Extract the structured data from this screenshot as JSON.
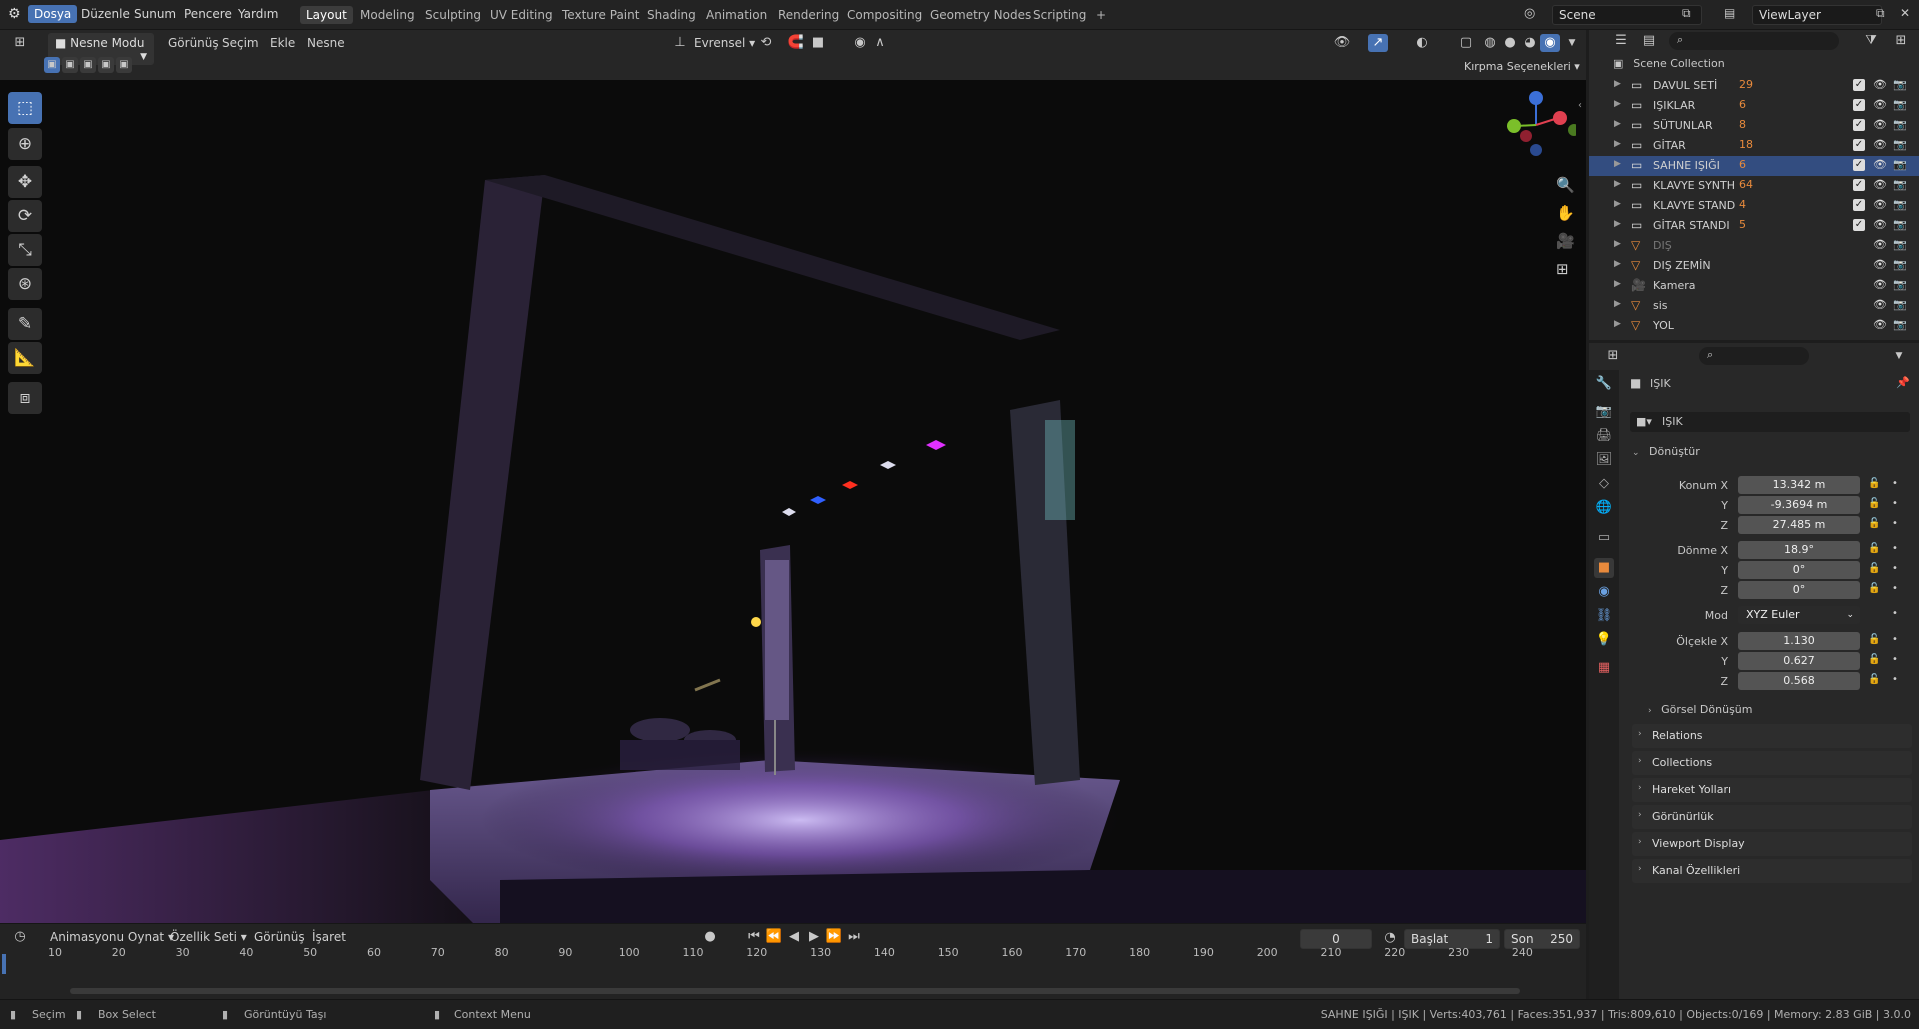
{
  "topbar": {
    "menus": [
      "Dosya",
      "Düzenle",
      "Sunum",
      "Pencere",
      "Yardım"
    ],
    "workspaces": [
      "Layout",
      "Modeling",
      "Sculpting",
      "UV Editing",
      "Texture Paint",
      "Shading",
      "Animation",
      "Rendering",
      "Compositing",
      "Geometry Nodes",
      "Scripting"
    ],
    "add_workspace": "+",
    "scene_label": "Scene",
    "viewlayer_label": "ViewLayer"
  },
  "viewport_header": {
    "mode": "Nesne Modu",
    "menus": [
      "Görünüş",
      "Seçim",
      "Ekle",
      "Nesne"
    ],
    "transform_orientation": "Evrensel",
    "clip_options": "Kırpma Seçenekleri"
  },
  "tools": [
    "select-box",
    "cursor",
    "move",
    "rotate",
    "scale",
    "transform",
    "annotate",
    "measure",
    "add-cube"
  ],
  "outliner": {
    "root": "Scene Collection",
    "rows": [
      {
        "name": "DAVUL SETİ",
        "count": "29",
        "type": "collection",
        "checked": true
      },
      {
        "name": "IŞIKLAR",
        "count": "6",
        "type": "collection",
        "checked": true
      },
      {
        "name": "SÜTUNLAR",
        "count": "8",
        "type": "collection",
        "checked": true
      },
      {
        "name": "GİTAR",
        "count": "18",
        "type": "collection",
        "checked": true
      },
      {
        "name": "SAHNE IŞIĞI",
        "count": "6",
        "type": "collection",
        "checked": true,
        "selected": true
      },
      {
        "name": "KLAVYE SYNTH",
        "count": "64",
        "type": "collection",
        "checked": true
      },
      {
        "name": "KLAVYE STAND",
        "count": "4",
        "type": "collection",
        "checked": true
      },
      {
        "name": "GİTAR STANDI",
        "count": "5",
        "type": "collection",
        "checked": true
      },
      {
        "name": "DIŞ",
        "count": "",
        "type": "mesh",
        "checked": false,
        "dim": true
      },
      {
        "name": "DIŞ ZEMİN",
        "count": "",
        "type": "mesh",
        "checked": false
      },
      {
        "name": "Kamera",
        "count": "",
        "type": "camera",
        "checked": false
      },
      {
        "name": "sis",
        "count": "",
        "type": "mesh",
        "checked": false
      },
      {
        "name": "YOL",
        "count": "",
        "type": "mesh",
        "checked": false
      }
    ]
  },
  "properties": {
    "object_name": "IŞIK",
    "data_name": "IŞIK",
    "transform_panel": "Dönüştür",
    "location_label": "Konum X",
    "location": [
      "13.342 m",
      "-9.3694 m",
      "27.485 m"
    ],
    "rotation_label": "Dönme X",
    "rotation": [
      "18.9°",
      "0°",
      "0°"
    ],
    "mode_label": "Mod",
    "mode_value": "XYZ Euler",
    "scale_label": "Ölçekle X",
    "scale": [
      "1.130",
      "0.627",
      "0.568"
    ],
    "y_label": "Y",
    "z_label": "Z",
    "delta_transform": "Görsel Dönüşüm",
    "panels": [
      "Relations",
      "Collections",
      "Hareket Yolları",
      "Görünürlük",
      "Viewport Display",
      "Kanal Özellikleri"
    ]
  },
  "timeline": {
    "playback": "Animasyonu Oynat",
    "keying": "Özellik Seti",
    "view": "Görünüş",
    "marker": "İşaret",
    "current_frame": "0",
    "start_label": "Başlat",
    "start": "1",
    "end_label": "Son",
    "end": "250",
    "ticks": [
      "10",
      "20",
      "30",
      "40",
      "50",
      "60",
      "70",
      "80",
      "90",
      "100",
      "110",
      "120",
      "130",
      "140",
      "150",
      "160",
      "170",
      "180",
      "190",
      "200",
      "210",
      "220",
      "230",
      "240"
    ]
  },
  "statusbar": {
    "select": "Seçim",
    "box_select": "Box Select",
    "pan": "Görüntüyü Taşı",
    "context": "Context Menu",
    "info": "SAHNE IŞIĞI | IŞIK | Verts:403,761 | Faces:351,937 | Tris:809,610 | Objects:0/169 | Memory: 2.83 GiB | 3.0.0"
  },
  "colors": {
    "accent": "#4772b3",
    "selected_row": "#334d80",
    "stage_purple": "#a070d0",
    "light_magenta": "#e030ff",
    "light_red": "#ff3020",
    "light_blue": "#3060ff"
  }
}
